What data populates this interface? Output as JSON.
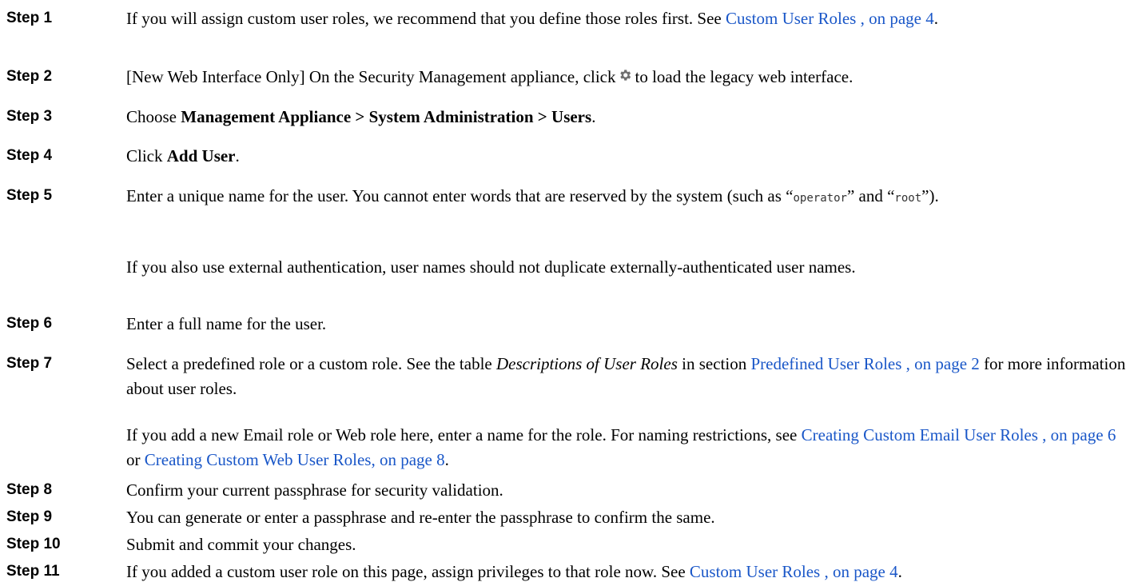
{
  "steps": [
    {
      "label": "Step 1",
      "t1": "If you will assign custom user roles, we recommend that you define those roles first. See ",
      "link": "Custom User Roles , on page 4",
      "t2": "."
    },
    {
      "label": "Step 2",
      "t1": "[New Web Interface Only] On the Security Management appliance, click",
      "icon": "gear-icon",
      "t2": "to load the legacy web interface."
    },
    {
      "label": "Step 3",
      "t1": "Choose ",
      "bold": "Management Appliance > System Administration > Users",
      "t2": "."
    },
    {
      "label": "Step 4",
      "t1": "Click ",
      "bold": "Add User",
      "t2": "."
    },
    {
      "label": "Step 5",
      "t1": "Enter a unique name for the user. You cannot enter words that are reserved by the system (such as “",
      "code1": "operator",
      "t2": "” and “",
      "code2": "root",
      "t3": "”).",
      "para2": "If you also use external authentication, user names should not duplicate externally-authenticated user names."
    },
    {
      "label": "Step 6",
      "t1": "Enter a full name for the user."
    },
    {
      "label": "Step 7",
      "t1": "Select a predefined role or a custom role. See the table ",
      "italic": "Descriptions of User Roles",
      "t2": " in section ",
      "link": "Predefined User Roles , on page 2",
      "t3": " for more information about user roles.",
      "p2_t1": "If you add a new Email role or Web role here, enter a name for the role. For naming restrictions, see ",
      "p2_link1": "Creating Custom Email User Roles , on page 6",
      "p2_t2": " or ",
      "p2_link2": "Creating Custom Web User Roles, on page 8",
      "p2_t3": "."
    },
    {
      "label": "Step 8",
      "t1": "Confirm your current passphrase for security validation."
    },
    {
      "label": "Step 9",
      "t1": "You can generate or enter a passphrase and re-enter the passphrase to confirm the same."
    },
    {
      "label": "Step 10",
      "t1": "Submit and commit your changes."
    },
    {
      "label": "Step 11",
      "t1": "If you added a custom user role on this page, assign privileges to that role now. See ",
      "link": "Custom User Roles , on page 4",
      "t2": "."
    }
  ],
  "colors": {
    "link": "#1a57c8",
    "text": "#000000",
    "gear_icon": "#6f6f6f"
  }
}
